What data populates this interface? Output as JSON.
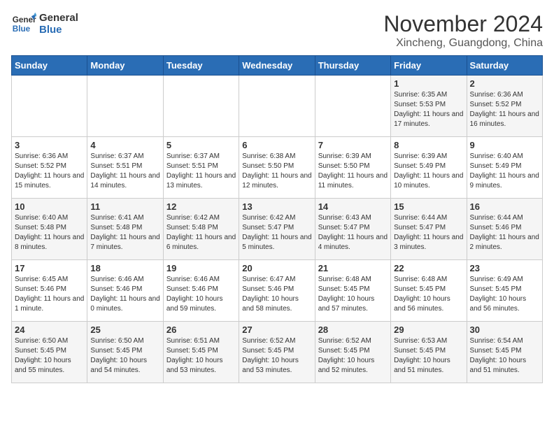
{
  "logo": {
    "line1": "General",
    "line2": "Blue"
  },
  "title": "November 2024",
  "subtitle": "Xincheng, Guangdong, China",
  "headers": [
    "Sunday",
    "Monday",
    "Tuesday",
    "Wednesday",
    "Thursday",
    "Friday",
    "Saturday"
  ],
  "weeks": [
    [
      {
        "day": "",
        "sunrise": "",
        "sunset": "",
        "daylight": ""
      },
      {
        "day": "",
        "sunrise": "",
        "sunset": "",
        "daylight": ""
      },
      {
        "day": "",
        "sunrise": "",
        "sunset": "",
        "daylight": ""
      },
      {
        "day": "",
        "sunrise": "",
        "sunset": "",
        "daylight": ""
      },
      {
        "day": "",
        "sunrise": "",
        "sunset": "",
        "daylight": ""
      },
      {
        "day": "1",
        "sunrise": "Sunrise: 6:35 AM",
        "sunset": "Sunset: 5:53 PM",
        "daylight": "Daylight: 11 hours and 17 minutes."
      },
      {
        "day": "2",
        "sunrise": "Sunrise: 6:36 AM",
        "sunset": "Sunset: 5:52 PM",
        "daylight": "Daylight: 11 hours and 16 minutes."
      }
    ],
    [
      {
        "day": "3",
        "sunrise": "Sunrise: 6:36 AM",
        "sunset": "Sunset: 5:52 PM",
        "daylight": "Daylight: 11 hours and 15 minutes."
      },
      {
        "day": "4",
        "sunrise": "Sunrise: 6:37 AM",
        "sunset": "Sunset: 5:51 PM",
        "daylight": "Daylight: 11 hours and 14 minutes."
      },
      {
        "day": "5",
        "sunrise": "Sunrise: 6:37 AM",
        "sunset": "Sunset: 5:51 PM",
        "daylight": "Daylight: 11 hours and 13 minutes."
      },
      {
        "day": "6",
        "sunrise": "Sunrise: 6:38 AM",
        "sunset": "Sunset: 5:50 PM",
        "daylight": "Daylight: 11 hours and 12 minutes."
      },
      {
        "day": "7",
        "sunrise": "Sunrise: 6:39 AM",
        "sunset": "Sunset: 5:50 PM",
        "daylight": "Daylight: 11 hours and 11 minutes."
      },
      {
        "day": "8",
        "sunrise": "Sunrise: 6:39 AM",
        "sunset": "Sunset: 5:49 PM",
        "daylight": "Daylight: 11 hours and 10 minutes."
      },
      {
        "day": "9",
        "sunrise": "Sunrise: 6:40 AM",
        "sunset": "Sunset: 5:49 PM",
        "daylight": "Daylight: 11 hours and 9 minutes."
      }
    ],
    [
      {
        "day": "10",
        "sunrise": "Sunrise: 6:40 AM",
        "sunset": "Sunset: 5:48 PM",
        "daylight": "Daylight: 11 hours and 8 minutes."
      },
      {
        "day": "11",
        "sunrise": "Sunrise: 6:41 AM",
        "sunset": "Sunset: 5:48 PM",
        "daylight": "Daylight: 11 hours and 7 minutes."
      },
      {
        "day": "12",
        "sunrise": "Sunrise: 6:42 AM",
        "sunset": "Sunset: 5:48 PM",
        "daylight": "Daylight: 11 hours and 6 minutes."
      },
      {
        "day": "13",
        "sunrise": "Sunrise: 6:42 AM",
        "sunset": "Sunset: 5:47 PM",
        "daylight": "Daylight: 11 hours and 5 minutes."
      },
      {
        "day": "14",
        "sunrise": "Sunrise: 6:43 AM",
        "sunset": "Sunset: 5:47 PM",
        "daylight": "Daylight: 11 hours and 4 minutes."
      },
      {
        "day": "15",
        "sunrise": "Sunrise: 6:44 AM",
        "sunset": "Sunset: 5:47 PM",
        "daylight": "Daylight: 11 hours and 3 minutes."
      },
      {
        "day": "16",
        "sunrise": "Sunrise: 6:44 AM",
        "sunset": "Sunset: 5:46 PM",
        "daylight": "Daylight: 11 hours and 2 minutes."
      }
    ],
    [
      {
        "day": "17",
        "sunrise": "Sunrise: 6:45 AM",
        "sunset": "Sunset: 5:46 PM",
        "daylight": "Daylight: 11 hours and 1 minute."
      },
      {
        "day": "18",
        "sunrise": "Sunrise: 6:46 AM",
        "sunset": "Sunset: 5:46 PM",
        "daylight": "Daylight: 11 hours and 0 minutes."
      },
      {
        "day": "19",
        "sunrise": "Sunrise: 6:46 AM",
        "sunset": "Sunset: 5:46 PM",
        "daylight": "Daylight: 10 hours and 59 minutes."
      },
      {
        "day": "20",
        "sunrise": "Sunrise: 6:47 AM",
        "sunset": "Sunset: 5:46 PM",
        "daylight": "Daylight: 10 hours and 58 minutes."
      },
      {
        "day": "21",
        "sunrise": "Sunrise: 6:48 AM",
        "sunset": "Sunset: 5:45 PM",
        "daylight": "Daylight: 10 hours and 57 minutes."
      },
      {
        "day": "22",
        "sunrise": "Sunrise: 6:48 AM",
        "sunset": "Sunset: 5:45 PM",
        "daylight": "Daylight: 10 hours and 56 minutes."
      },
      {
        "day": "23",
        "sunrise": "Sunrise: 6:49 AM",
        "sunset": "Sunset: 5:45 PM",
        "daylight": "Daylight: 10 hours and 56 minutes."
      }
    ],
    [
      {
        "day": "24",
        "sunrise": "Sunrise: 6:50 AM",
        "sunset": "Sunset: 5:45 PM",
        "daylight": "Daylight: 10 hours and 55 minutes."
      },
      {
        "day": "25",
        "sunrise": "Sunrise: 6:50 AM",
        "sunset": "Sunset: 5:45 PM",
        "daylight": "Daylight: 10 hours and 54 minutes."
      },
      {
        "day": "26",
        "sunrise": "Sunrise: 6:51 AM",
        "sunset": "Sunset: 5:45 PM",
        "daylight": "Daylight: 10 hours and 53 minutes."
      },
      {
        "day": "27",
        "sunrise": "Sunrise: 6:52 AM",
        "sunset": "Sunset: 5:45 PM",
        "daylight": "Daylight: 10 hours and 53 minutes."
      },
      {
        "day": "28",
        "sunrise": "Sunrise: 6:52 AM",
        "sunset": "Sunset: 5:45 PM",
        "daylight": "Daylight: 10 hours and 52 minutes."
      },
      {
        "day": "29",
        "sunrise": "Sunrise: 6:53 AM",
        "sunset": "Sunset: 5:45 PM",
        "daylight": "Daylight: 10 hours and 51 minutes."
      },
      {
        "day": "30",
        "sunrise": "Sunrise: 6:54 AM",
        "sunset": "Sunset: 5:45 PM",
        "daylight": "Daylight: 10 hours and 51 minutes."
      }
    ]
  ]
}
